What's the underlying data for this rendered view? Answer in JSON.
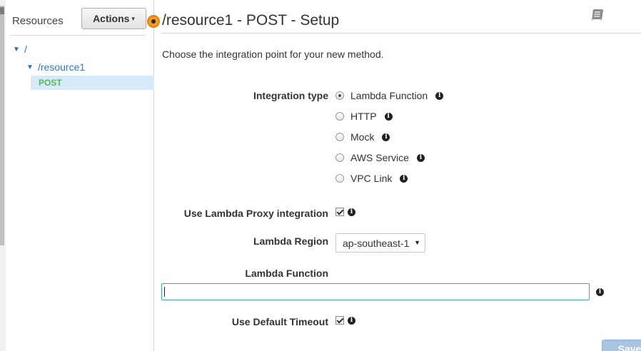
{
  "sidebar": {
    "title": "Resources",
    "actions_label": "Actions",
    "tree": {
      "root": "/",
      "resource": "/resource1",
      "method": "POST"
    }
  },
  "header": {
    "title": "/resource1 - POST - Setup"
  },
  "intro": "Choose the integration point for your new method.",
  "form": {
    "integration_type_label": "Integration type",
    "integration_types": [
      {
        "label": "Lambda Function",
        "selected": true
      },
      {
        "label": "HTTP",
        "selected": false
      },
      {
        "label": "Mock",
        "selected": false
      },
      {
        "label": "AWS Service",
        "selected": false
      },
      {
        "label": "VPC Link",
        "selected": false
      }
    ],
    "proxy_label": "Use Lambda Proxy integration",
    "proxy_checked": true,
    "region_label": "Lambda Region",
    "region_value": "ap-southeast-1",
    "function_label": "Lambda Function",
    "function_value": "",
    "timeout_label": "Use Default Timeout",
    "timeout_checked": true,
    "save_label": "Save"
  },
  "colors": {
    "accent_orange": "#f49b22",
    "link_blue": "#3478b8",
    "method_green": "#5cb85c",
    "selected_row": "#d6e9f8",
    "input_focus": "#45a1c9"
  },
  "icons": [
    "book-icon",
    "info-icon",
    "caret-down-icon"
  ]
}
